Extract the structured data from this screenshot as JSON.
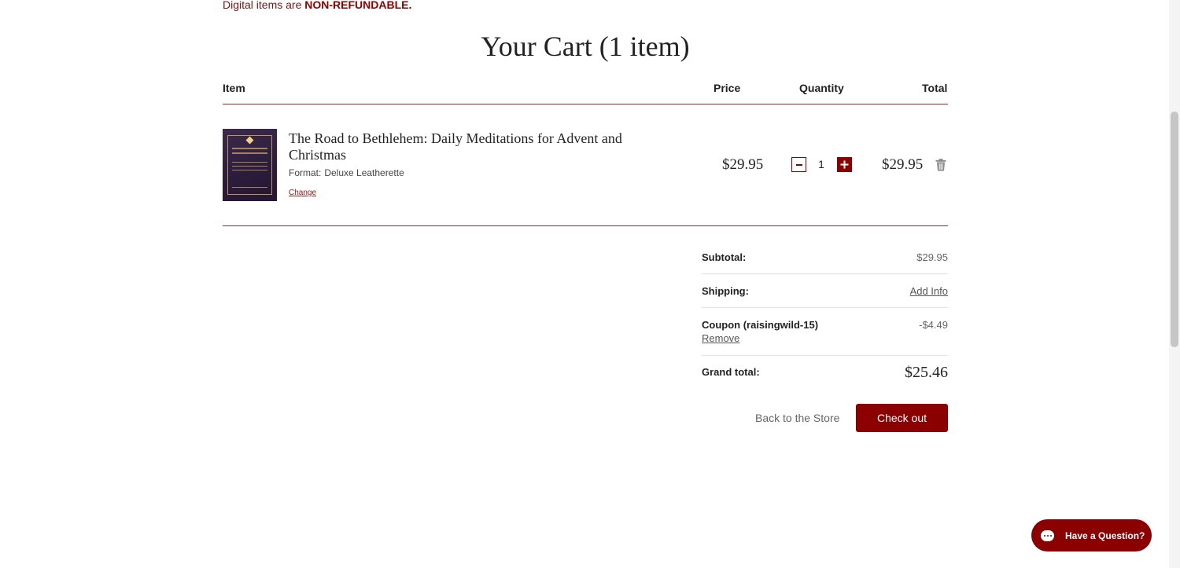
{
  "notice": {
    "prefix": "Digital items are",
    "emphasis": "NON-REFUNDABLE."
  },
  "cart": {
    "title": "Your Cart (1 item)"
  },
  "table_headers": {
    "item": "Item",
    "price": "Price",
    "quantity": "Quantity",
    "total": "Total"
  },
  "items": [
    {
      "title": "The Road to Bethlehem: Daily Meditations for Advent and Christmas",
      "format_label": "Format:",
      "format_value": "Deluxe Leatherette",
      "change_label": "Change",
      "price": "$29.95",
      "quantity": "1",
      "total": "$29.95",
      "cover_color": "#2e1f3e"
    }
  ],
  "summary": {
    "subtotal_label": "Subtotal:",
    "subtotal_value": "$29.95",
    "shipping_label": "Shipping:",
    "shipping_action": "Add Info",
    "coupon_label": "Coupon (raisingwild-15)",
    "coupon_remove": "Remove",
    "coupon_value": "-$4.49",
    "grand_total_label": "Grand total:",
    "grand_total_value": "$25.46"
  },
  "actions": {
    "back_to_store": "Back to the Store",
    "checkout": "Check out"
  },
  "chat": {
    "label": "Have a Question?"
  },
  "colors": {
    "accent": "#8b0000",
    "rule": "#9b2c2c",
    "text": "#222222",
    "muted": "#666666"
  },
  "icons": {
    "trash": "trash-icon",
    "minus": "minus-icon",
    "plus": "plus-icon",
    "chat": "chat-bubble-icon"
  }
}
